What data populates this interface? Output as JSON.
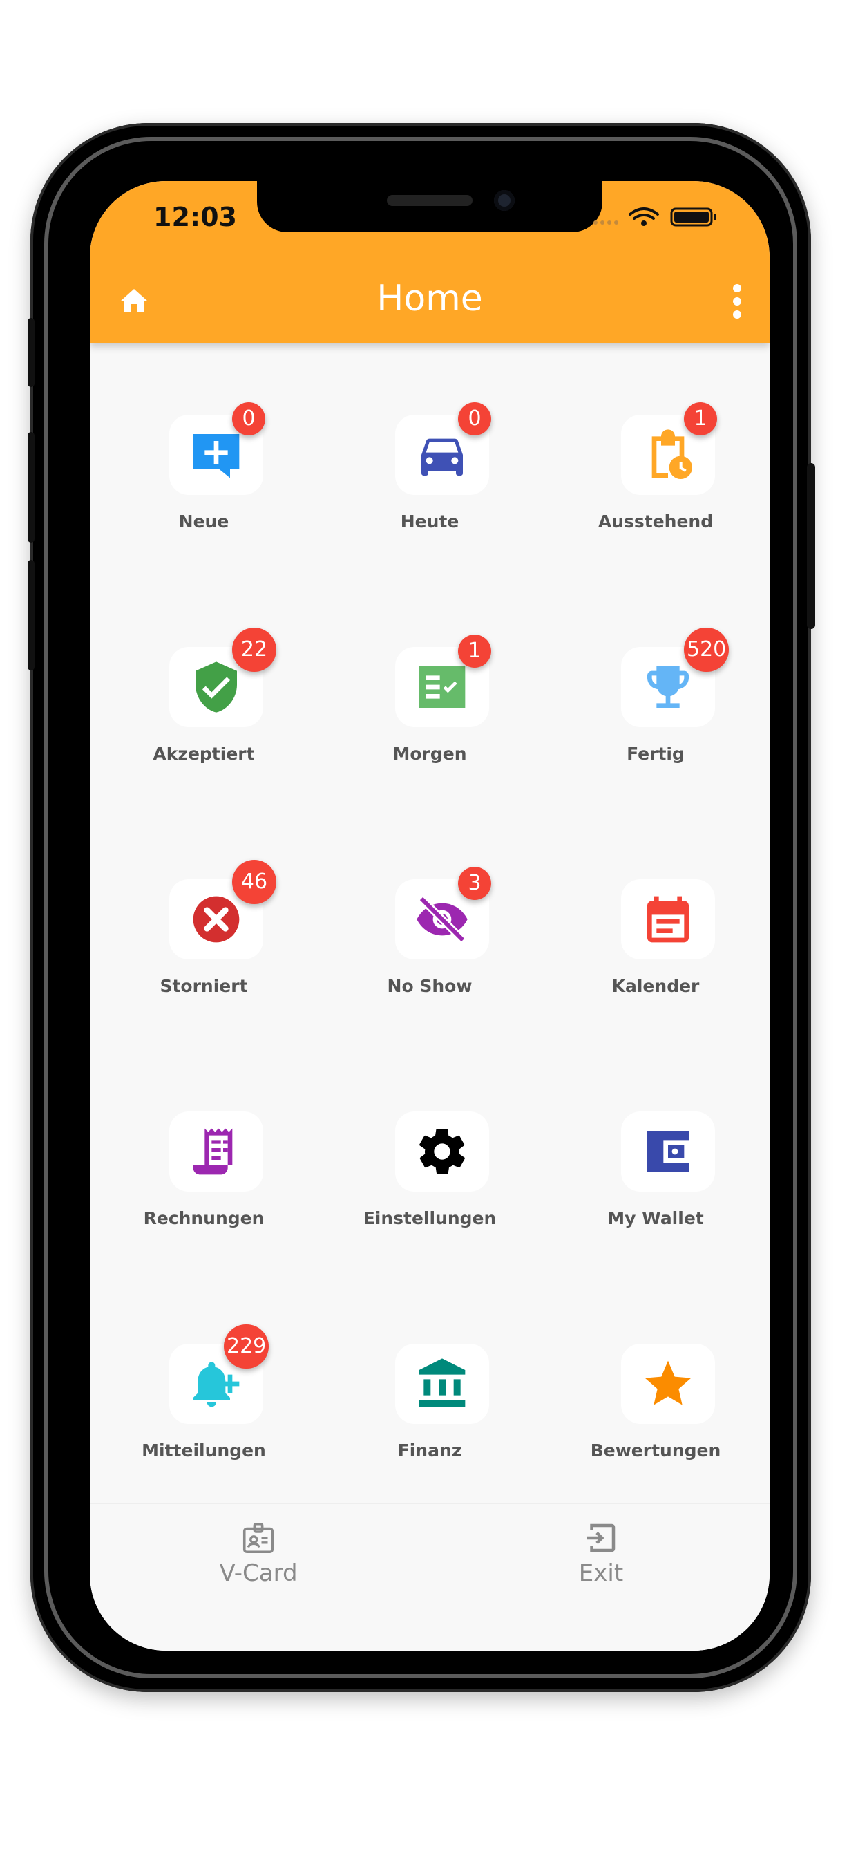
{
  "status_bar": {
    "time": "12:03"
  },
  "app_bar": {
    "title": "Home"
  },
  "tiles": [
    {
      "label": "Neue",
      "badge": "0",
      "icon": "chat-plus-icon",
      "color": "#2196f3"
    },
    {
      "label": "Heute",
      "badge": "0",
      "icon": "car-icon",
      "color": "#3f51b5"
    },
    {
      "label": "Ausstehend",
      "badge": "1",
      "icon": "clipboard-clock-icon",
      "color": "#ffa726"
    },
    {
      "label": "Akzeptiert",
      "badge": "22",
      "icon": "shield-check-icon",
      "color": "#43a047"
    },
    {
      "label": "Morgen",
      "badge": "1",
      "icon": "checklist-icon",
      "color": "#66bb6a"
    },
    {
      "label": "Fertig",
      "badge": "520",
      "icon": "trophy-icon",
      "color": "#64b5f6"
    },
    {
      "label": "Storniert",
      "badge": "46",
      "icon": "cancel-circle-icon",
      "color": "#d32f2f"
    },
    {
      "label": "No Show",
      "badge": "3",
      "icon": "eye-off-icon",
      "color": "#9c27b0"
    },
    {
      "label": "Kalender",
      "badge": "",
      "icon": "calendar-icon",
      "color": "#f44336"
    },
    {
      "label": "Rechnungen",
      "badge": "",
      "icon": "receipt-icon",
      "color": "#9c27b0"
    },
    {
      "label": "Einstellungen",
      "badge": "",
      "icon": "gear-icon",
      "color": "#000000"
    },
    {
      "label": "My Wallet",
      "badge": "",
      "icon": "wallet-icon",
      "color": "#3949ab"
    },
    {
      "label": "Mitteilungen",
      "badge": "229",
      "icon": "bell-plus-icon",
      "color": "#26c6da"
    },
    {
      "label": "Finanz",
      "badge": "",
      "icon": "bank-icon",
      "color": "#00897b"
    },
    {
      "label": "Bewertungen",
      "badge": "",
      "icon": "star-icon",
      "color": "#fb8c00"
    }
  ],
  "bottom_nav": [
    {
      "label": "V-Card",
      "icon": "id-badge-icon"
    },
    {
      "label": "Exit",
      "icon": "exit-icon"
    }
  ],
  "colors": {
    "accent": "#ffa726",
    "badge": "#f44336"
  }
}
